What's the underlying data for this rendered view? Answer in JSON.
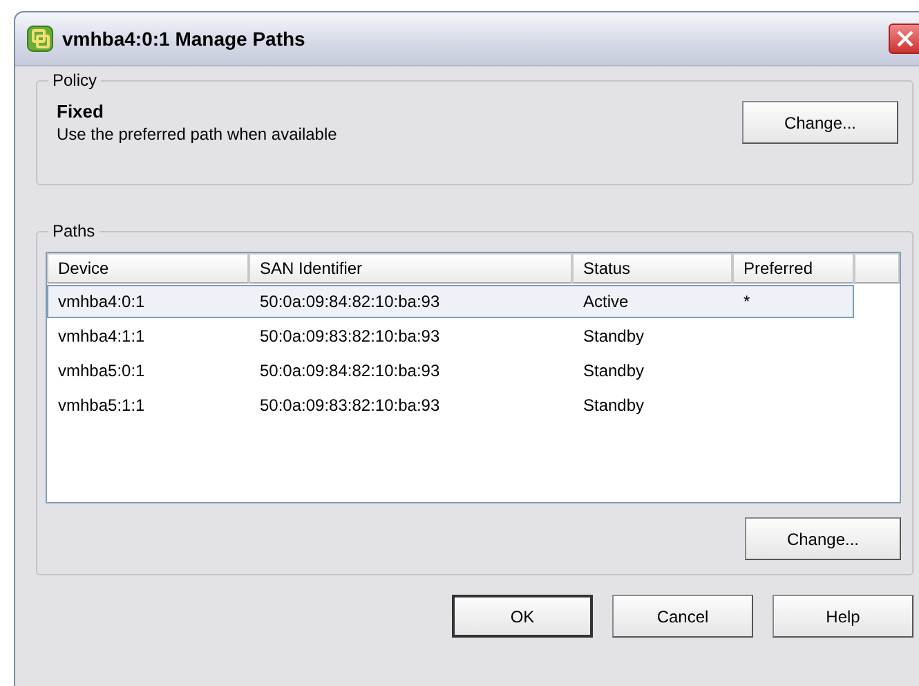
{
  "window": {
    "title": "vmhba4:0:1 Manage Paths"
  },
  "policy": {
    "legend": "Policy",
    "name": "Fixed",
    "description": "Use the preferred path when available",
    "button": "Change..."
  },
  "paths": {
    "legend": "Paths",
    "columns": [
      "Device",
      "SAN Identifier",
      "Status",
      "Preferred"
    ],
    "rows": [
      {
        "device": "vmhba4:0:1",
        "san_identifier": "50:0a:09:84:82:10:ba:93",
        "status": "Active",
        "preferred": "*",
        "selected": true
      },
      {
        "device": "vmhba4:1:1",
        "san_identifier": "50:0a:09:83:82:10:ba:93",
        "status": "Standby",
        "selected": false
      },
      {
        "device": "vmhba5:0:1",
        "san_identifier": "50:0a:09:84:82:10:ba:93",
        "status": "Standby",
        "selected": false
      },
      {
        "device": "vmhba5:1:1",
        "san_identifier": "50:0a:09:83:82:10:ba:93",
        "status": "Standby",
        "selected": false
      }
    ],
    "button": "Change..."
  },
  "buttons": [
    "OK",
    "Cancel",
    "Help"
  ]
}
